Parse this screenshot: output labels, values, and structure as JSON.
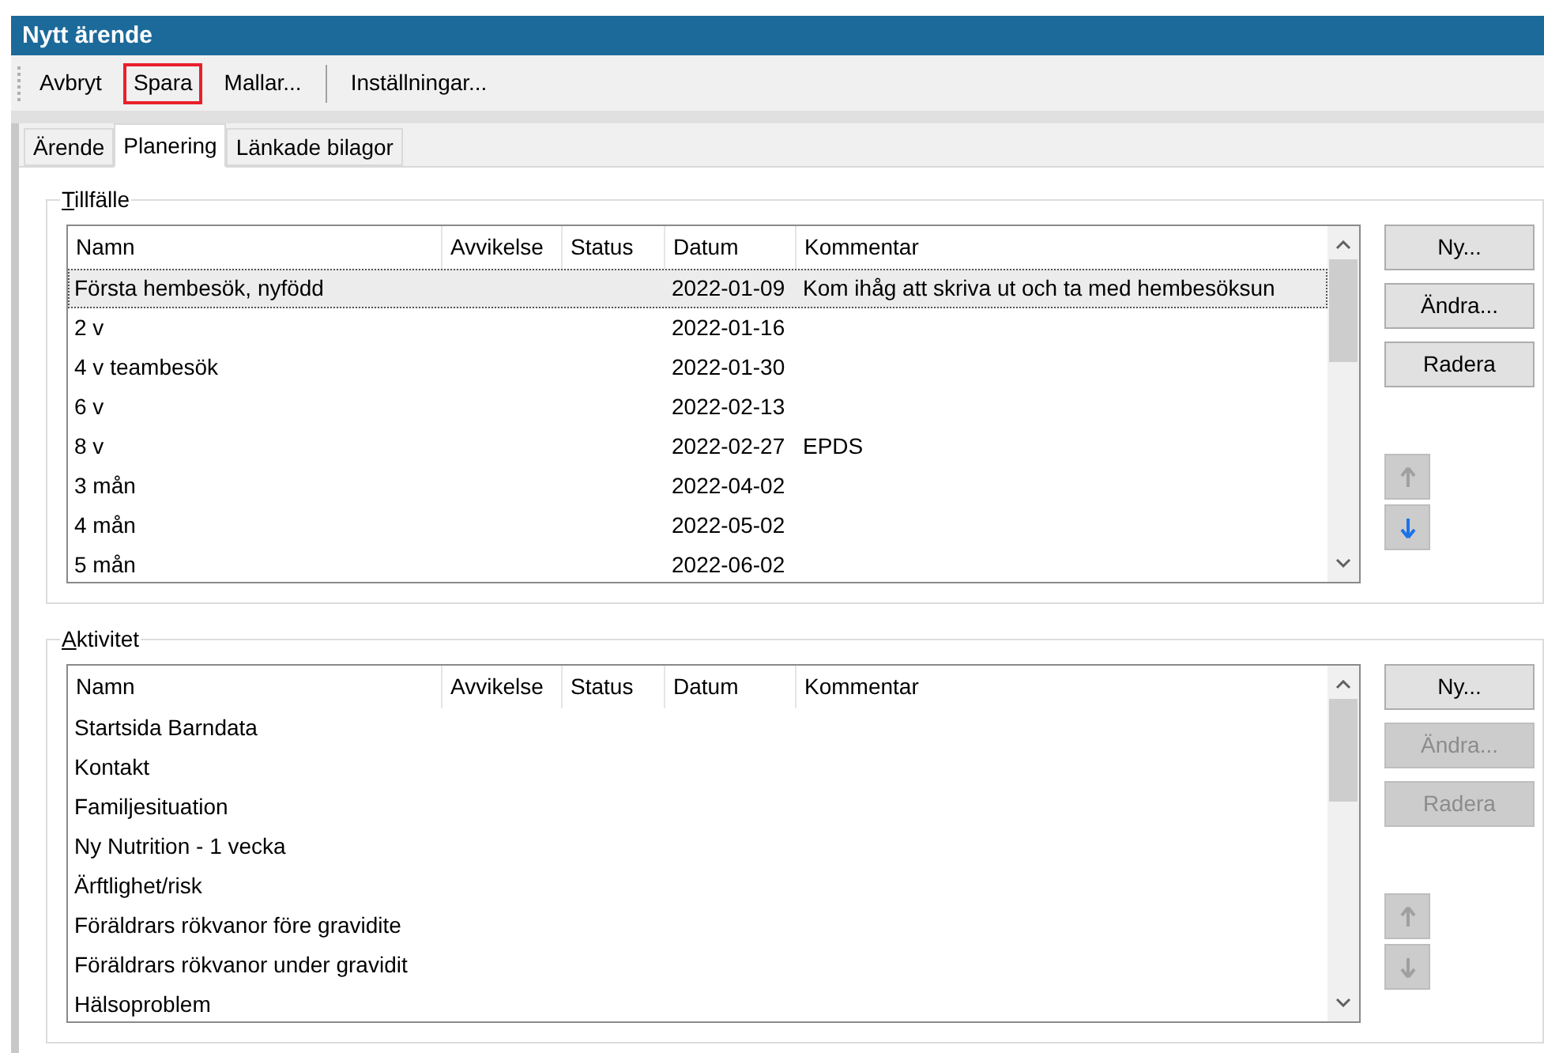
{
  "window": {
    "title": "Nytt ärende"
  },
  "toolbar": [
    {
      "kind": "button",
      "label": "Avbryt",
      "highlighted": false
    },
    {
      "kind": "button",
      "label": "Spara",
      "highlighted": true
    },
    {
      "kind": "button",
      "label": "Mallar...",
      "highlighted": false
    },
    {
      "kind": "separator"
    },
    {
      "kind": "button",
      "label": "Inställningar...",
      "highlighted": false
    }
  ],
  "tabs": [
    {
      "label": "Ärende",
      "selected": false
    },
    {
      "label": "Planering",
      "selected": true
    },
    {
      "label": "Länkade bilagor",
      "selected": false
    }
  ],
  "groups": [
    {
      "title": "Tillfälle",
      "columns": [
        "Namn",
        "Avvikelse",
        "Status",
        "Datum",
        "Kommentar"
      ],
      "rows": [
        {
          "cells": [
            "Första hembesök, nyfödd",
            "",
            "",
            "2022-01-09",
            "Kom ihåg att skriva ut och ta med hembesöksun"
          ],
          "selected": true
        },
        {
          "cells": [
            "2 v",
            "",
            "",
            "2022-01-16",
            ""
          ],
          "selected": false
        },
        {
          "cells": [
            "4 v teambesök",
            "",
            "",
            "2022-01-30",
            ""
          ],
          "selected": false
        },
        {
          "cells": [
            "6 v",
            "",
            "",
            "2022-02-13",
            ""
          ],
          "selected": false
        },
        {
          "cells": [
            "8 v",
            "",
            "",
            "2022-02-27",
            "EPDS"
          ],
          "selected": false
        },
        {
          "cells": [
            "3 mån",
            "",
            "",
            "2022-04-02",
            ""
          ],
          "selected": false
        },
        {
          "cells": [
            "4 mån",
            "",
            "",
            "2022-05-02",
            ""
          ],
          "selected": false
        },
        {
          "cells": [
            "5 mån",
            "",
            "",
            "2022-06-02",
            ""
          ],
          "selected": false
        }
      ],
      "buttons": [
        {
          "label": "Ny...",
          "disabled": false
        },
        {
          "label": "Ändra...",
          "disabled": false
        },
        {
          "label": "Radera",
          "disabled": false
        }
      ],
      "move_up": {
        "disabled": true
      },
      "move_down": {
        "disabled": false
      }
    },
    {
      "title": "Aktivitet",
      "columns": [
        "Namn",
        "Avvikelse",
        "Status",
        "Datum",
        "Kommentar"
      ],
      "rows": [
        {
          "cells": [
            "Startsida Barndata",
            "",
            "",
            "",
            ""
          ],
          "selected": false
        },
        {
          "cells": [
            "Kontakt",
            "",
            "",
            "",
            ""
          ],
          "selected": false
        },
        {
          "cells": [
            "Familjesituation",
            "",
            "",
            "",
            ""
          ],
          "selected": false
        },
        {
          "cells": [
            "Ny Nutrition - 1 vecka",
            "",
            "",
            "",
            ""
          ],
          "selected": false
        },
        {
          "cells": [
            "Ärftlighet/risk",
            "",
            "",
            "",
            ""
          ],
          "selected": false
        },
        {
          "cells": [
            "Föräldrars rökvanor före gravidite",
            "",
            "",
            "",
            ""
          ],
          "selected": false
        },
        {
          "cells": [
            "Föräldrars rökvanor under gravidit",
            "",
            "",
            "",
            ""
          ],
          "selected": false
        },
        {
          "cells": [
            "Hälsoproblem",
            "",
            "",
            "",
            ""
          ],
          "selected": false
        }
      ],
      "buttons": [
        {
          "label": "Ny...",
          "disabled": false
        },
        {
          "label": "Ändra...",
          "disabled": true
        },
        {
          "label": "Radera",
          "disabled": true
        }
      ],
      "move_up": {
        "disabled": true
      },
      "move_down": {
        "disabled": true
      }
    }
  ]
}
